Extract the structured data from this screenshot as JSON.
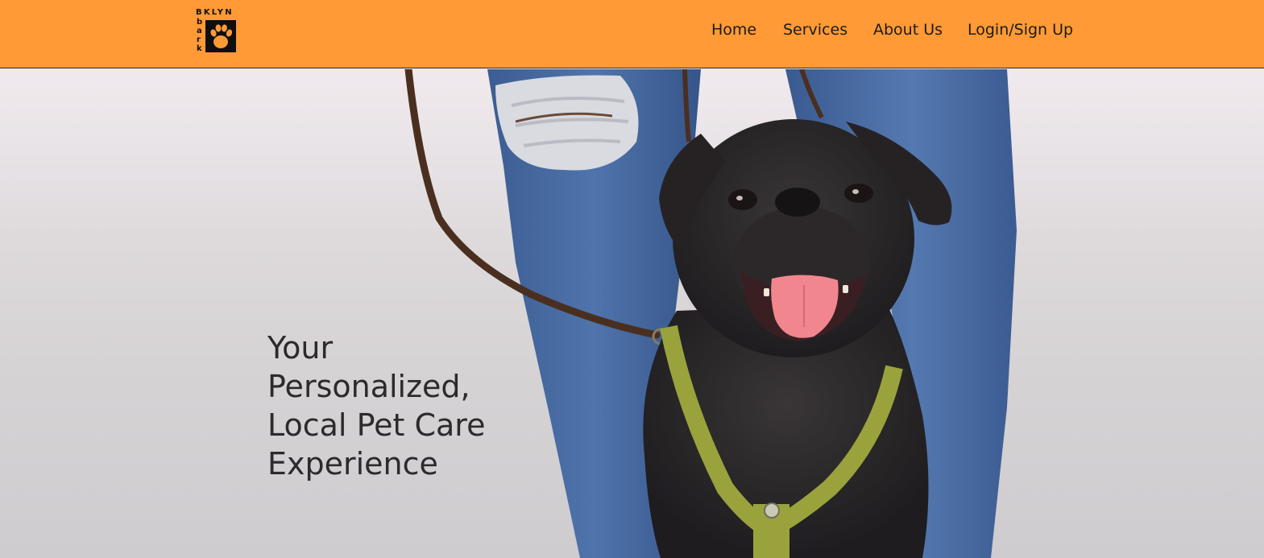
{
  "header": {
    "background_color": "#ff9a36",
    "logo": {
      "top_text": "BKLYN",
      "side_text": "bark",
      "icon": "paw-print-icon"
    },
    "nav": [
      {
        "label": "Home"
      },
      {
        "label": "Services"
      },
      {
        "label": "About Us"
      },
      {
        "label": "Login/Sign Up"
      }
    ]
  },
  "hero": {
    "image": "pug-on-leash-between-legs-photo",
    "headline": "Your Personalized, Local Pet Care Experience"
  }
}
